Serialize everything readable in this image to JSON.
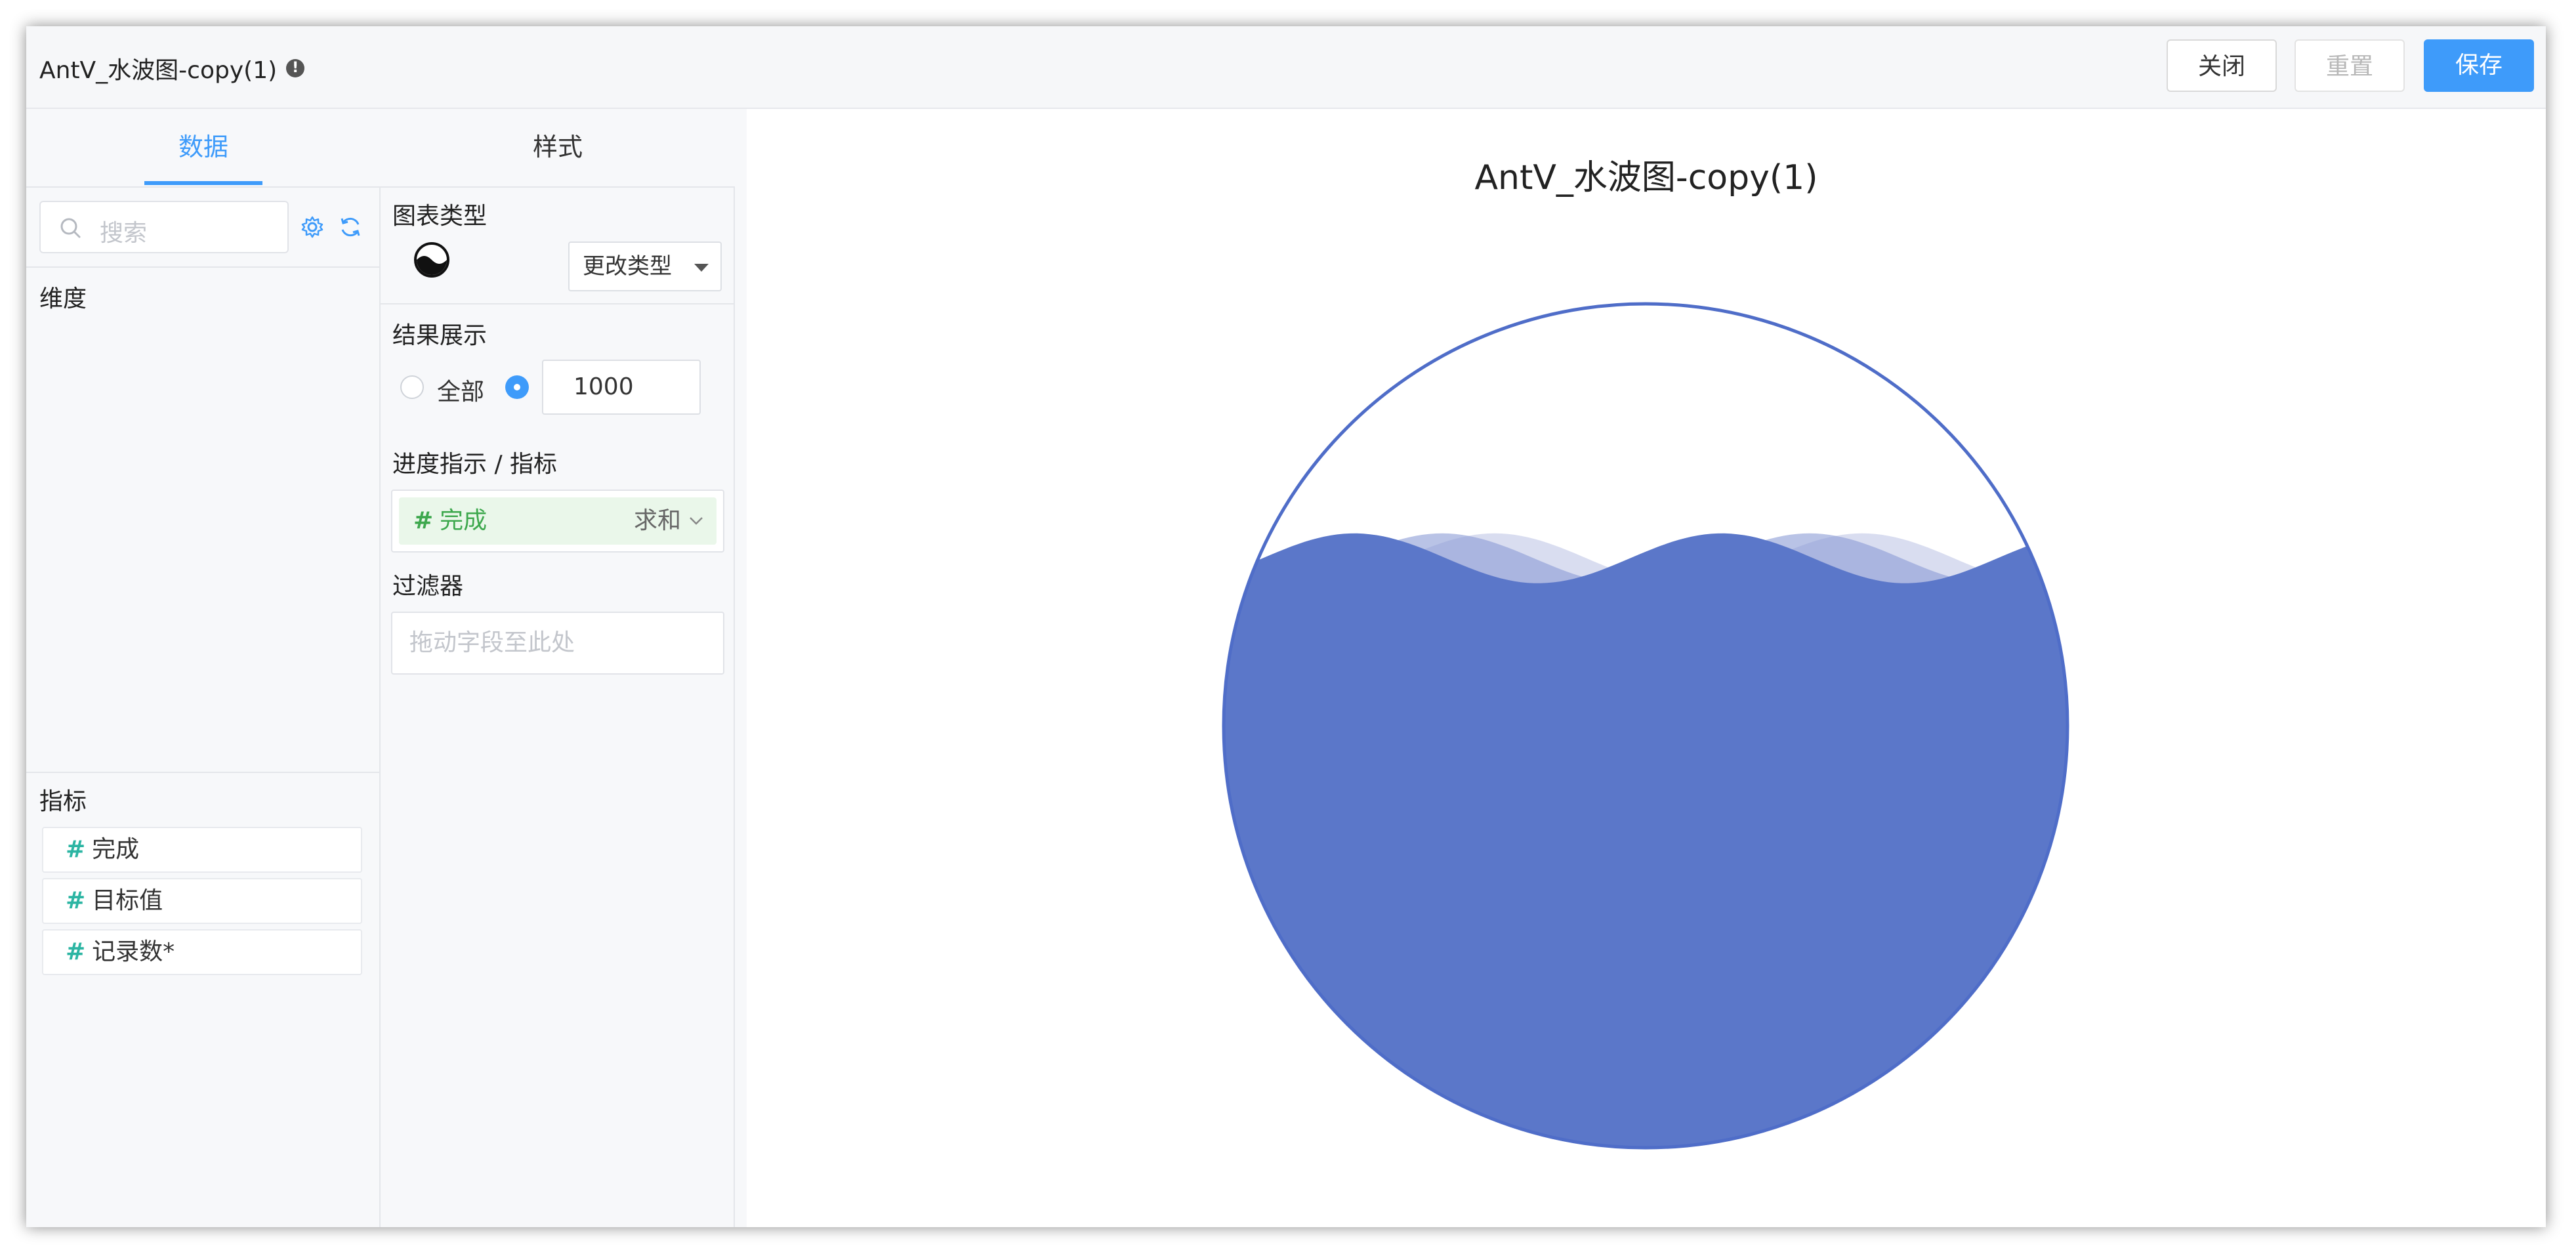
{
  "header": {
    "title": "AntV_水波图-copy(1)",
    "info_icon": "info-icon",
    "buttons": {
      "close": "关闭",
      "reset": "重置",
      "save": "保存"
    }
  },
  "tabs": {
    "data": "数据",
    "style": "样式"
  },
  "data_panel": {
    "search_placeholder": "搜索",
    "icons": [
      "settings-icon",
      "refresh-icon"
    ],
    "dimensions_label": "维度",
    "metrics_label": "指标",
    "metrics": [
      "完成",
      "目标值",
      "记录数*"
    ]
  },
  "config_panel": {
    "chart_type_label": "图表类型",
    "chart_type_icon": "liquid-chart-icon",
    "change_type_label": "更改类型",
    "result_label": "结果展示",
    "result_all_label": "全部",
    "result_limit_value": "1000",
    "result_selected": "limit",
    "progress_label": "进度指示 / 指标",
    "progress_field": {
      "name": "完成",
      "aggregation": "求和"
    },
    "filter_label": "过滤器",
    "filter_placeholder": "拖动字段至此处"
  },
  "chart_data": {
    "type": "liquid",
    "title": "AntV_水波图-copy(1)",
    "value_percent": 70,
    "colors": {
      "fill": "#5b77c9",
      "wave_light": "#d9ddf0",
      "outline": "#4f6dc8"
    },
    "label_visible": false
  },
  "colors": {
    "accent": "#3e9bfa",
    "metric_hash": "#2cb5a3",
    "progress_pill_bg": "#eaf7ea",
    "progress_pill_text": "#3ea84e"
  }
}
